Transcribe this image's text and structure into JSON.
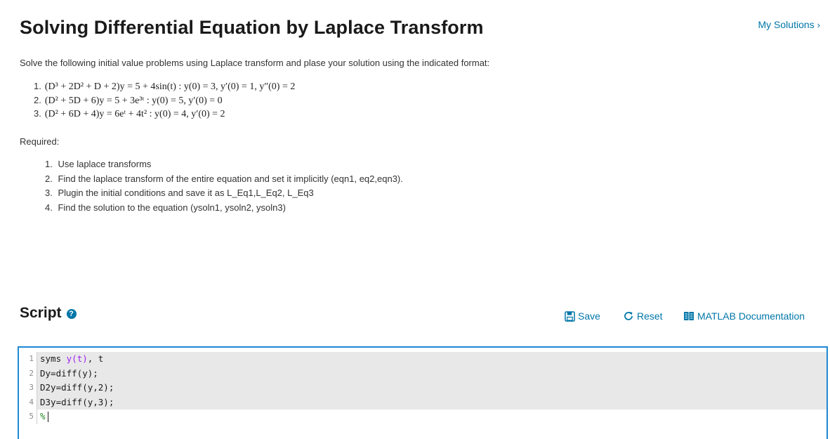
{
  "header": {
    "title": "Solving Differential Equation by Laplace Transform",
    "my_solutions": "My Solutions",
    "chevron": "›"
  },
  "intro": "Solve the following initial value problems using Laplace transform and plase your solution using the indicated format:",
  "problems": [
    {
      "num": "1.",
      "eq": "(D³ + 2D² + D + 2)y = 5 + 4sin(t) : y(0) = 3, y′(0) = 1, y″(0) = 2"
    },
    {
      "num": "2.",
      "eq": "(D² + 5D + 6)y = 5 + 3e³ᵗ : y(0) = 5, y′(0) = 0"
    },
    {
      "num": "3.",
      "eq": "(D² + 6D + 4)y = 6eᵗ + 4t² : y(0) = 4, y′(0) = 2"
    }
  ],
  "required_label": "Required:",
  "requirements": [
    {
      "num": "1.",
      "text": "Use laplace transforms"
    },
    {
      "num": "2.",
      "text": "Find the laplace transform of the entire equation and set it implicitly (eqn1, eq2,eqn3)."
    },
    {
      "num": "3.",
      "text": "Plugin the initial conditions and save it as L_Eq1,L_Eq2, L_Eq3"
    },
    {
      "num": "4.",
      "text": "Find the solution to the equation (ysoln1, ysoln2, ysoln3)"
    }
  ],
  "script": {
    "heading": "Script",
    "help_icon": "?",
    "save_label": "Save",
    "reset_label": "Reset",
    "doc_label": "MATLAB Documentation"
  },
  "code": {
    "lines": [
      {
        "num": "1",
        "pre": "syms ",
        "var": "y(t)",
        "post": ", t"
      },
      {
        "num": "2",
        "pre": "Dy=diff(y);"
      },
      {
        "num": "3",
        "pre": "D2y=diff(y,2);"
      },
      {
        "num": "4",
        "pre": "D3y=diff(y,3);"
      },
      {
        "num": "5",
        "comment": "%"
      }
    ]
  },
  "colors": {
    "accent": "#0076a8",
    "editor_border": "#1e88d4",
    "line_shade": "#e8e8e8",
    "matlab_var": "#a020f0",
    "matlab_comment": "#228b22"
  },
  "icons": {
    "save": "floppy-disk-icon",
    "reset": "refresh-icon",
    "doc": "book-icon",
    "help": "question-circle-icon"
  }
}
